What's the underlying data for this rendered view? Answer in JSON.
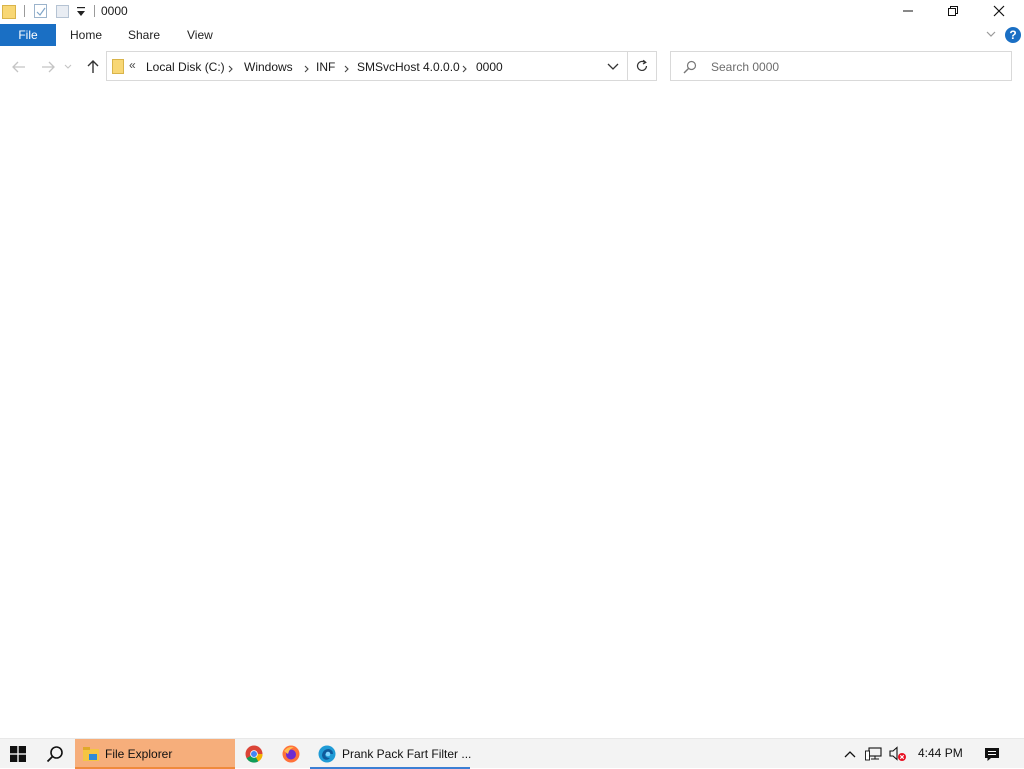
{
  "window": {
    "title": "0000"
  },
  "ribbon": {
    "tabs": [
      {
        "label": "File",
        "active": true
      },
      {
        "label": "Home"
      },
      {
        "label": "Share"
      },
      {
        "label": "View"
      }
    ],
    "help_label": "?"
  },
  "address_bar": {
    "overflow": "«",
    "breadcrumbs": [
      "Local Disk (C:)",
      "Windows",
      "INF",
      "SMSvcHost 4.0.0.0",
      "0000"
    ]
  },
  "search": {
    "placeholder": "Search 0000"
  },
  "content": {
    "items": []
  },
  "taskbar": {
    "apps": [
      {
        "label": "File Explorer",
        "icon": "file-explorer-icon",
        "active": true
      },
      {
        "label": "",
        "icon": "chrome-icon"
      },
      {
        "label": "",
        "icon": "firefox-icon"
      },
      {
        "label": "Prank Pack Fart Filter ...",
        "icon": "edge-icon",
        "open": true
      }
    ],
    "clock": "4:44 PM"
  },
  "colors": {
    "accent": "#1a6fc4",
    "taskbar_active": "#f6ae7b"
  }
}
